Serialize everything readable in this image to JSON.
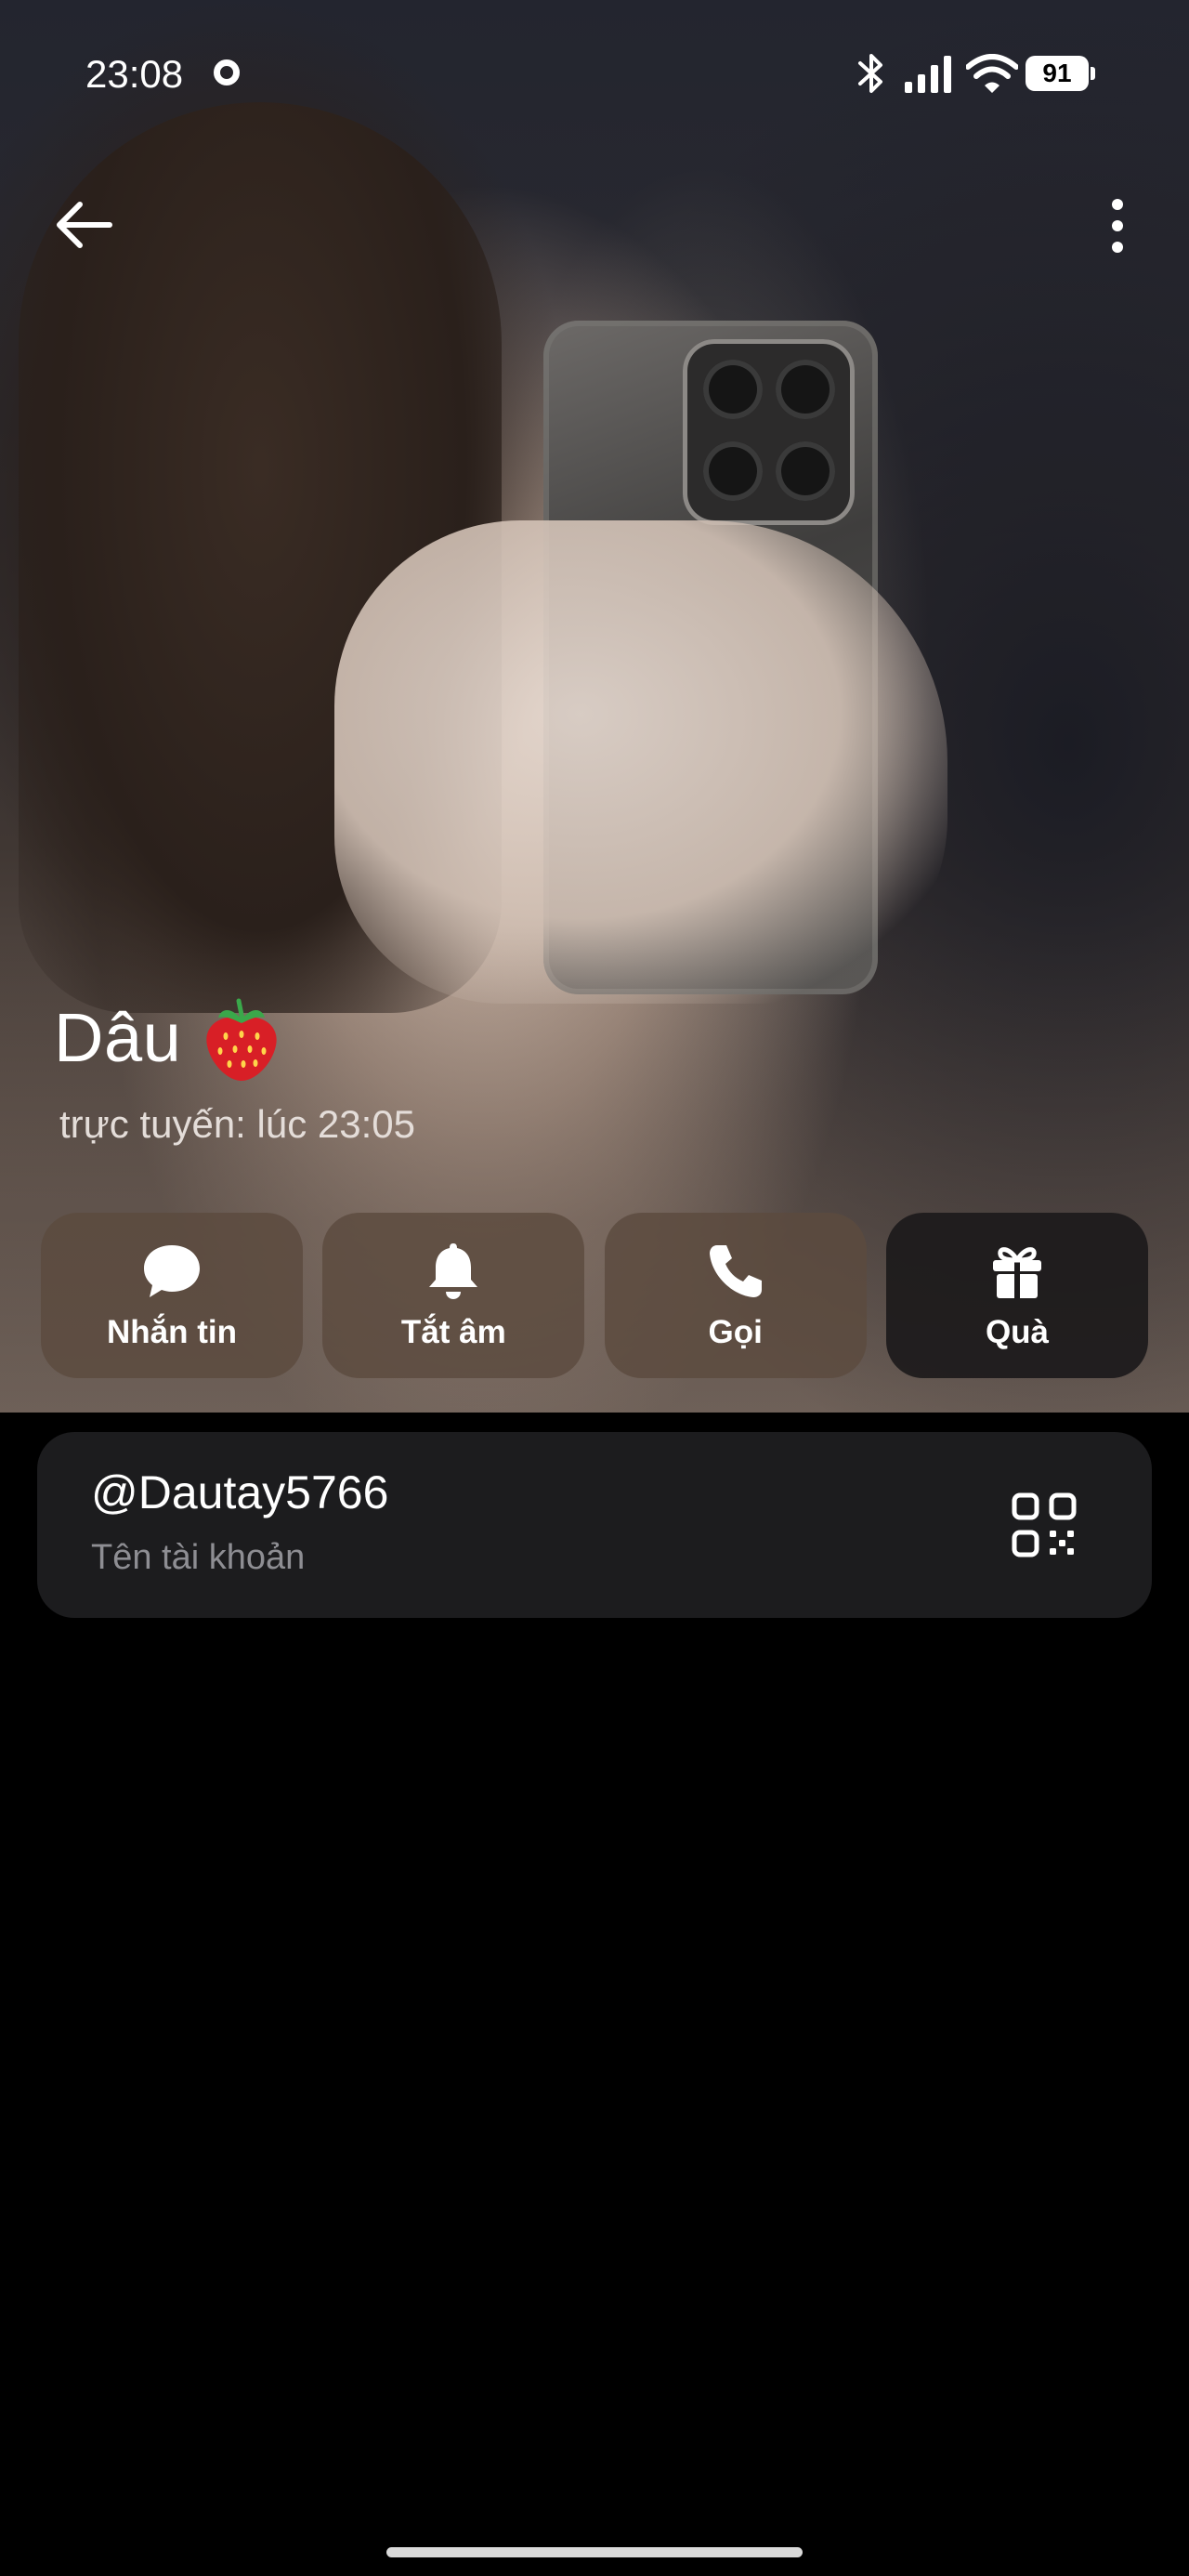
{
  "status_bar": {
    "time": "23:08",
    "battery": "91"
  },
  "profile": {
    "name": "Dâu",
    "last_seen": "trực tuyến: lúc 23:05"
  },
  "actions": [
    {
      "label": "Nhắn tin",
      "icon": "chat-bubble-icon"
    },
    {
      "label": "Tắt âm",
      "icon": "bell-icon"
    },
    {
      "label": "Gọi",
      "icon": "phone-icon"
    },
    {
      "label": "Quà",
      "icon": "gift-icon"
    }
  ],
  "account": {
    "username": "@Dautay5766",
    "caption": "Tên tài khoản"
  },
  "colors": {
    "background": "#000000",
    "card": "#1c1c1e",
    "action_button": "#5c4a3e",
    "action_button_dark": "#1c1a1b",
    "secondary_text": "#8e8e93"
  }
}
